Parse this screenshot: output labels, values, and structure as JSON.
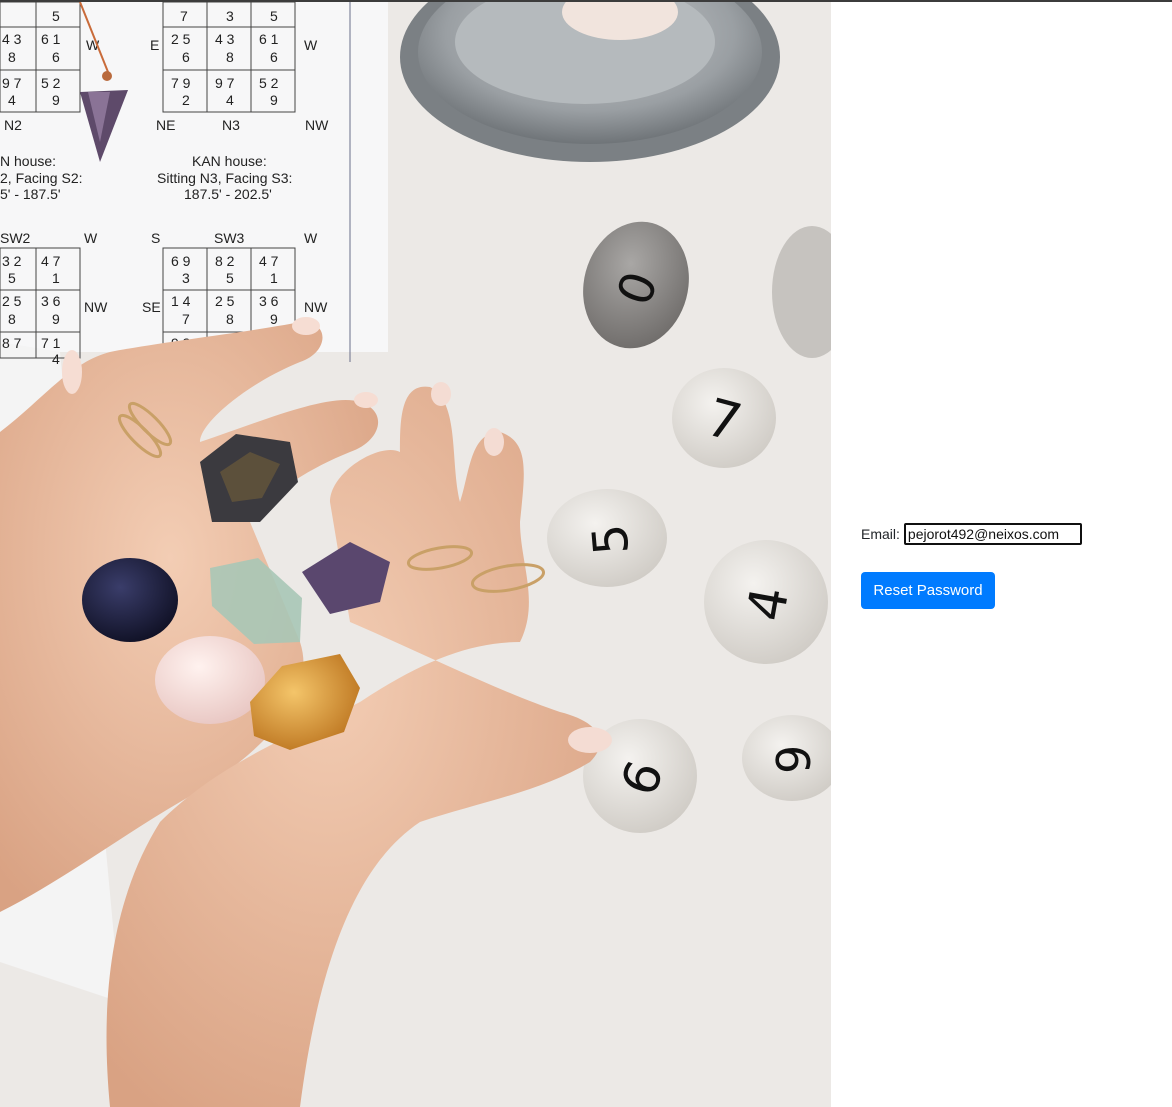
{
  "form": {
    "email_label": "Email:",
    "email_value": "pejorot492@neixos.com",
    "reset_button_label": "Reset Password"
  },
  "hero_image": {
    "description_icon": "crystals-and-number-stones-photo",
    "chart_sheet": {
      "cells_top": [
        "5",
        "7",
        "3",
        "5"
      ],
      "rows_a": [
        "4 3",
        "6 1",
        "W",
        "E",
        "2 5",
        "4 3",
        "6 1",
        "W"
      ],
      "rows_a_sub": [
        "8",
        "6",
        "6",
        "8",
        "6"
      ],
      "rows_b": [
        "9 7",
        "5 2",
        "7 9",
        "9 7",
        "5 2"
      ],
      "rows_b_sub": [
        "4",
        "9",
        "2",
        "4",
        "9"
      ],
      "dir_labels_1": [
        "N2",
        "NE",
        "N3",
        "NW"
      ],
      "house_left_title": "N house:",
      "house_left_line1": "2, Facing S2:",
      "house_left_line2": "5' - 187.5'",
      "house_right_title": "KAN house:",
      "house_right_line1": "Sitting N3, Facing S3:",
      "house_right_line2": "187.5' - 202.5'",
      "dir_labels_2": [
        "SW2",
        "W",
        "S",
        "SW3",
        "W"
      ],
      "grid2_row1": [
        "3 2",
        "4 7",
        "6 9",
        "8 2",
        "4 7"
      ],
      "grid2_row1_sub": [
        "5",
        "1",
        "3",
        "5",
        "1"
      ],
      "grid2_row2": [
        "2 5",
        "3 6",
        "NW",
        "SE",
        "1 4",
        "2 5",
        "3 6",
        "NW"
      ],
      "grid2_row2_sub": [
        "8",
        "9",
        "7",
        "8",
        "9"
      ],
      "grid2_row3": [
        "8 7",
        "7 1",
        "9 3"
      ],
      "grid2_row3_sub": [
        "4"
      ]
    },
    "stones": [
      "0",
      "7",
      "5",
      "4",
      "6",
      "9"
    ]
  }
}
